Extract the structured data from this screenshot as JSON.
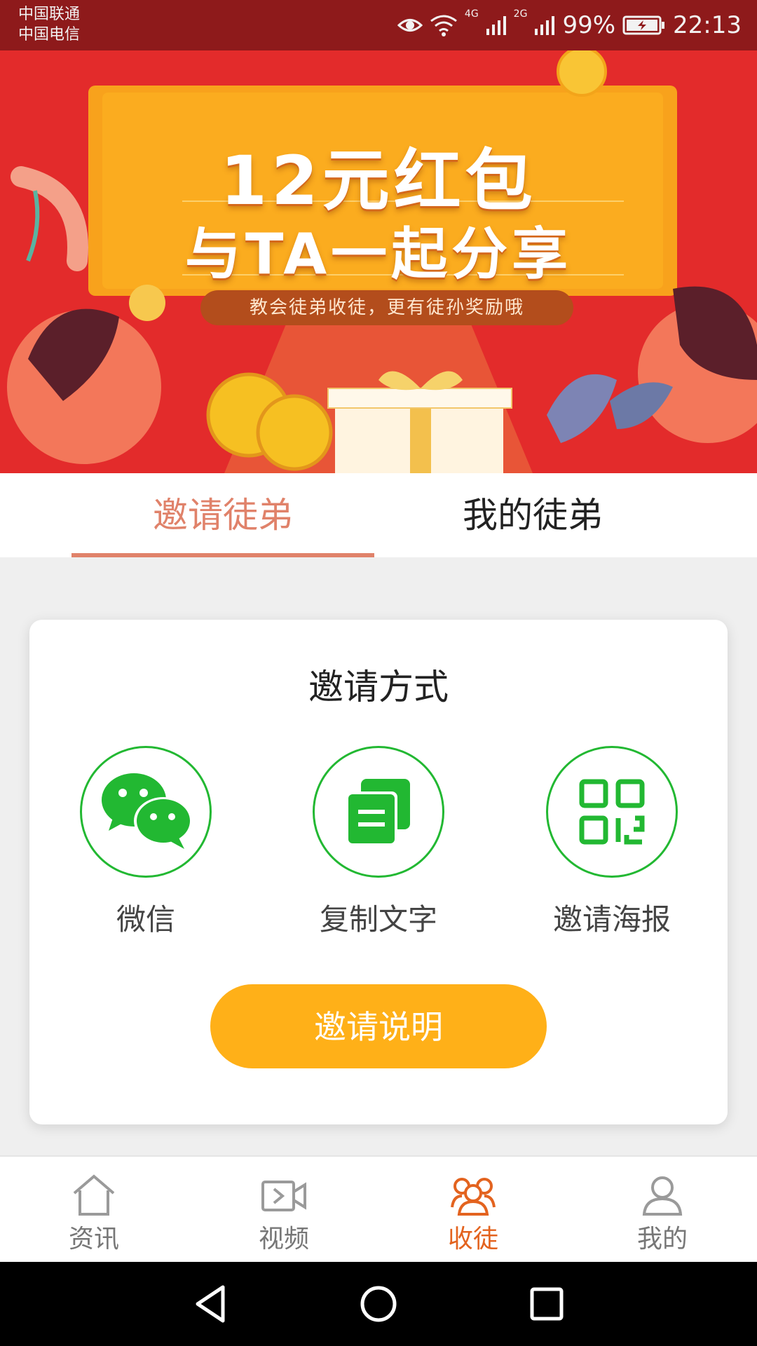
{
  "status_bar": {
    "carrier_1": "中国联通",
    "carrier_2": "中国电信",
    "network_1": "4G",
    "network_2": "2G",
    "battery": "99%",
    "time": "22:13"
  },
  "banner": {
    "title_line1": "12元红包",
    "title_line2": "与TA一起分享",
    "subtitle": "教会徒弟收徒，更有徒孙奖励哦"
  },
  "tabs": [
    {
      "label": "邀请徒弟",
      "active": true
    },
    {
      "label": "我的徒弟",
      "active": false
    }
  ],
  "invite_card": {
    "title": "邀请方式",
    "methods": [
      {
        "label": "微信",
        "icon": "wechat-icon"
      },
      {
        "label": "复制文字",
        "icon": "copy-text-icon"
      },
      {
        "label": "邀请海报",
        "icon": "qr-code-icon"
      }
    ],
    "explain_button": "邀请说明"
  },
  "bottom_nav": [
    {
      "label": "资讯",
      "icon": "home-icon",
      "active": false
    },
    {
      "label": "视频",
      "icon": "video-icon",
      "active": false
    },
    {
      "label": "收徒",
      "icon": "apprentice-group-icon",
      "active": true
    },
    {
      "label": "我的",
      "icon": "user-icon",
      "active": false
    }
  ],
  "colors": {
    "status_bar": "#8e1a1b",
    "banner_bg": "#e32b2b",
    "tab_active": "#e0826a",
    "icon_green": "#22b832",
    "button_yellow": "#ffb018",
    "nav_active": "#e3631f"
  }
}
